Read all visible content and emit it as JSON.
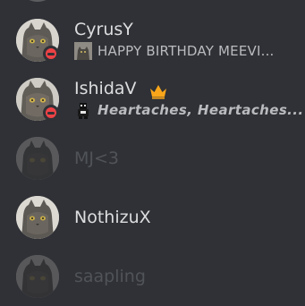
{
  "members": [
    {
      "username": "CyrusY",
      "status": "dnd",
      "activity_emoji": "cat-photo-emoji",
      "activity_text": "HAPPY BIRTHDAY MEEVI..."
    },
    {
      "username": "IshidaV",
      "status": "dnd",
      "owner_badge": "crown-icon",
      "activity_emoji": "pixel-character-emoji",
      "activity_text": "Heartaches, Heartaches..."
    },
    {
      "username": "MJ<3",
      "status": "offline"
    },
    {
      "username": "NothizuX",
      "status": "online"
    },
    {
      "username": "saapling",
      "status": "offline"
    }
  ],
  "colors": {
    "background": "#2f3136",
    "dnd": "#ed4245",
    "crown": "#faa61a",
    "name": "#dcddde",
    "activity": "#b9bbbe"
  }
}
